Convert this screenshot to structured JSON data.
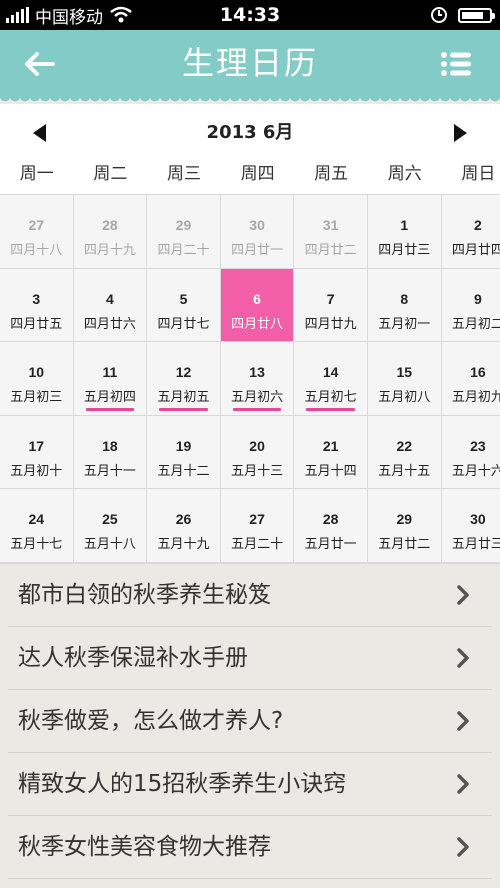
{
  "status_bar": {
    "carrier": "中国移动",
    "time": "14:33",
    "battery_level": 0.8
  },
  "header": {
    "title": "生理日历"
  },
  "calendar": {
    "month_label": "2013 6月",
    "weekdays": [
      "周一",
      "周二",
      "周三",
      "周四",
      "周五",
      "周六",
      "周日"
    ],
    "days": [
      {
        "day": "27",
        "lunar": "四月十八",
        "other": true
      },
      {
        "day": "28",
        "lunar": "四月十九",
        "other": true
      },
      {
        "day": "29",
        "lunar": "四月二十",
        "other": true
      },
      {
        "day": "30",
        "lunar": "四月廿一",
        "other": true
      },
      {
        "day": "31",
        "lunar": "四月廿二",
        "other": true
      },
      {
        "day": "1",
        "lunar": "四月廿三"
      },
      {
        "day": "2",
        "lunar": "四月廿四"
      },
      {
        "day": "3",
        "lunar": "四月廿五"
      },
      {
        "day": "4",
        "lunar": "四月廿六"
      },
      {
        "day": "5",
        "lunar": "四月廿七"
      },
      {
        "day": "6",
        "lunar": "四月廿八",
        "today": true
      },
      {
        "day": "7",
        "lunar": "四月廿九"
      },
      {
        "day": "8",
        "lunar": "五月初一"
      },
      {
        "day": "9",
        "lunar": "五月初二"
      },
      {
        "day": "10",
        "lunar": "五月初三"
      },
      {
        "day": "11",
        "lunar": "五月初四",
        "marked": true
      },
      {
        "day": "12",
        "lunar": "五月初五",
        "marked": true
      },
      {
        "day": "13",
        "lunar": "五月初六",
        "marked": true
      },
      {
        "day": "14",
        "lunar": "五月初七",
        "marked": true
      },
      {
        "day": "15",
        "lunar": "五月初八"
      },
      {
        "day": "16",
        "lunar": "五月初九"
      },
      {
        "day": "17",
        "lunar": "五月初十"
      },
      {
        "day": "18",
        "lunar": "五月十一"
      },
      {
        "day": "19",
        "lunar": "五月十二"
      },
      {
        "day": "20",
        "lunar": "五月十三"
      },
      {
        "day": "21",
        "lunar": "五月十四"
      },
      {
        "day": "22",
        "lunar": "五月十五"
      },
      {
        "day": "23",
        "lunar": "五月十六"
      },
      {
        "day": "24",
        "lunar": "五月十七"
      },
      {
        "day": "25",
        "lunar": "五月十八"
      },
      {
        "day": "26",
        "lunar": "五月十九"
      },
      {
        "day": "27",
        "lunar": "五月二十"
      },
      {
        "day": "28",
        "lunar": "五月廿一"
      },
      {
        "day": "29",
        "lunar": "五月廿二"
      },
      {
        "day": "30",
        "lunar": "五月廿三"
      }
    ]
  },
  "articles": [
    {
      "title": "都市白领的秋季养生秘笈"
    },
    {
      "title": "达人秋季保湿补水手册"
    },
    {
      "title": "秋季做爱，怎么做才养人?"
    },
    {
      "title": "精致女人的15招秋季养生小诀窍"
    },
    {
      "title": "秋季女性美容食物大推荐"
    }
  ],
  "colors": {
    "header_teal": "#82cbc6",
    "today_pink": "#f25ea8",
    "mark_pink": "#e7469a",
    "list_bg": "#ebe9e4"
  },
  "icons": [
    "signal-bars-icon",
    "wifi-icon",
    "alarm-clock-icon",
    "battery-icon",
    "back-arrow-icon",
    "list-menu-icon",
    "prev-month-icon",
    "next-month-icon",
    "chevron-right-icon"
  ]
}
